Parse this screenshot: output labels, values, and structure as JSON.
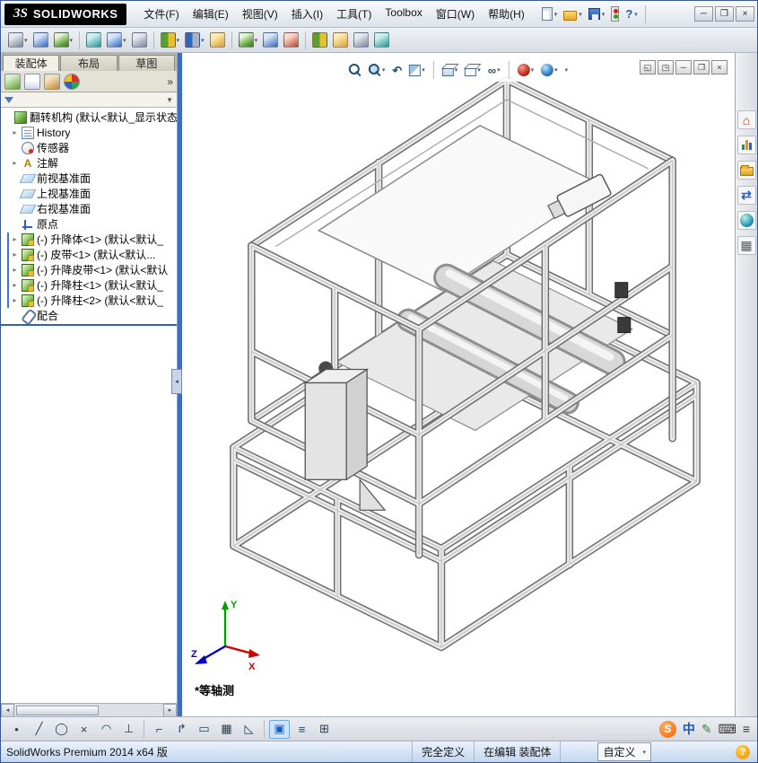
{
  "colors": {
    "accent_blue": "#2a5fd0",
    "splitter": "#3e6cc6",
    "sogou_orange": "#f06000",
    "chrome": "#dfe2e7"
  },
  "titlebar": {
    "logo_mark": "3S",
    "logo_text": "SOLIDWORKS",
    "menus": [
      "文件(F)",
      "编辑(E)",
      "视图(V)",
      "插入(I)",
      "工具(T)",
      "Toolbox",
      "窗口(W)",
      "帮助(H)"
    ],
    "quick_icons": [
      "new-document",
      "open",
      "save",
      "rebuild",
      "help"
    ],
    "help_glyph": "?",
    "window_controls": [
      "─",
      "❐",
      "×"
    ]
  },
  "assembly_toolbar": {
    "icons": [
      "insert-components",
      "mate",
      "linear-component-pattern",
      "smart-fasteners",
      "move-component",
      "show-hidden-components",
      "assembly-features",
      "reference-geometry",
      "new-motion-study",
      "bill-of-materials",
      "exploded-view",
      "explode-line-sketch",
      "interference-detection",
      "instant-3d",
      "external-references",
      "large-assembly-mode"
    ]
  },
  "left_panel": {
    "tabs": [
      {
        "label": "装配体"
      },
      {
        "label": "布局"
      },
      {
        "label": "草图"
      }
    ],
    "fm_overflow": "»",
    "tree": {
      "items": [
        {
          "label": "翻转机构 (默认<默认_显示状态",
          "icon": "assembly"
        },
        {
          "label": "History",
          "icon": "history"
        },
        {
          "label": "传感器",
          "icon": "sensors"
        },
        {
          "label": "注解",
          "icon": "annotations"
        },
        {
          "label": "前视基准面",
          "icon": "plane"
        },
        {
          "label": "上视基准面",
          "icon": "plane"
        },
        {
          "label": "右视基准面",
          "icon": "plane"
        },
        {
          "label": "原点",
          "icon": "origin"
        },
        {
          "label": "(-) 升降体<1> (默认<默认_",
          "icon": "component"
        },
        {
          "label": "(-) 皮带<1> (默认<默认...",
          "icon": "component"
        },
        {
          "label": "(-) 升降皮带<1> (默认<默认",
          "icon": "component"
        },
        {
          "label": "(-) 升降柱<1> (默认<默认_",
          "icon": "component"
        },
        {
          "label": "(-) 升降柱<2> (默认<默认_",
          "icon": "component"
        },
        {
          "label": "配合",
          "icon": "mates"
        }
      ]
    }
  },
  "viewport": {
    "view_label": "*等轴测",
    "headsup_icons": [
      "zoom-to-fit",
      "zoom-to-area",
      "previous-view",
      "section-view",
      "view-orientation",
      "display-style",
      "hide-show-items",
      "edit-appearance",
      "apply-scene",
      "view-settings"
    ],
    "headsup_glyphs": {
      "previous_view": "↶",
      "hide_show": "∞",
      "dropdown": "▾"
    },
    "doc_buttons": [
      "◱",
      "◳",
      "─",
      "❐",
      "×"
    ],
    "triad_axes": {
      "x": "X",
      "y": "Y",
      "z": "Z"
    }
  },
  "taskpane": {
    "icons": [
      "solidworks-resources",
      "solidworks-forum",
      "design-library",
      "file-explorer",
      "appearances-scenes",
      "custom-properties"
    ]
  },
  "bottom_toolbar": {
    "tools": [
      {
        "name": "sketch-point-tool",
        "glyph": "•"
      },
      {
        "name": "line-tool",
        "glyph": "╱"
      },
      {
        "name": "circle-tool",
        "glyph": "◯"
      },
      {
        "name": "trim-tool",
        "glyph": "×"
      },
      {
        "name": "arc-tool",
        "glyph": "◠"
      },
      {
        "name": "perpendicular-tool",
        "glyph": "⊥"
      },
      {
        "name": "offset-tool",
        "glyph": "⌐"
      },
      {
        "name": "mirror-tool",
        "glyph": "↱"
      },
      {
        "name": "rectangle-tool",
        "glyph": "▭"
      },
      {
        "name": "grid-tool",
        "glyph": "▦"
      },
      {
        "name": "angle-tool",
        "glyph": "◺"
      },
      {
        "name": "normal-to-tool",
        "glyph": "▣"
      },
      {
        "name": "list-tool",
        "glyph": "≡"
      },
      {
        "name": "add-view-tool",
        "glyph": "⊞"
      }
    ]
  },
  "ime": {
    "logo": "S",
    "mode": "中",
    "pen": "✎",
    "keyboard": "⌨",
    "menu": "≡"
  },
  "statusbar": {
    "app": "SolidWorks Premium 2014 x64 版",
    "define_status": "完全定义",
    "editing_status": "在编辑 装配体",
    "custom_label": "自定义",
    "dropdown": "▾",
    "help_glyph": "?"
  }
}
